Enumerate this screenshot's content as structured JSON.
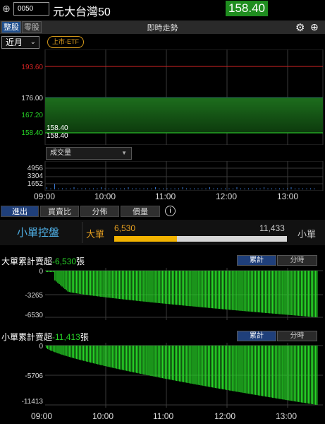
{
  "header": {
    "stock_code": "0050",
    "stock_name": "元大台灣50",
    "price": "158.40",
    "price_color": "#1f8d1f"
  },
  "tabs": {
    "whole_lot": "整股",
    "odd_lot": "零股",
    "title": "即時走勢"
  },
  "controls": {
    "period": "近月",
    "badge": "上市-ETF",
    "volume_select": "成交量"
  },
  "price_chart": {
    "y_labels": [
      {
        "text": "193.60",
        "color": "#d42424"
      },
      {
        "text": "176.00",
        "color": "#dddddd"
      },
      {
        "text": "167.20",
        "color": "#27d427"
      },
      {
        "text": "158.40",
        "color": "#27d427"
      }
    ],
    "last_labels": [
      "158.40",
      "158.40"
    ]
  },
  "volume_chart": {
    "y_labels": [
      "4956",
      "3304",
      "1652"
    ]
  },
  "time_axis": [
    "09:00",
    "10:00",
    "11:00",
    "12:00",
    "13:00"
  ],
  "bottom_tabs": [
    "進出",
    "買賣比",
    "分佈",
    "價量"
  ],
  "flow_panel": {
    "control_label": "小單控盤",
    "big_label": "大單",
    "big_value": "6,530",
    "small_value": "11,433",
    "small_label": "小單",
    "big_share": 0.363
  },
  "big_section": {
    "title_prefix": "大單累計賣超",
    "title_value": "-6,530",
    "title_unit": "張",
    "toggle_on": "累計",
    "toggle_off": "分時",
    "y_labels": [
      "0",
      "-3265",
      "-6530"
    ]
  },
  "small_section": {
    "title_prefix": "小單累計賣超",
    "title_value": "-11,413",
    "title_unit": "張",
    "toggle_on": "累計",
    "toggle_off": "分時",
    "y_labels": [
      "0",
      "-5706",
      "-11413"
    ]
  },
  "colors": {
    "accent_blue": "#1f3f7a",
    "bar_green": "#27d427",
    "big_orange": "#f2b300"
  }
}
